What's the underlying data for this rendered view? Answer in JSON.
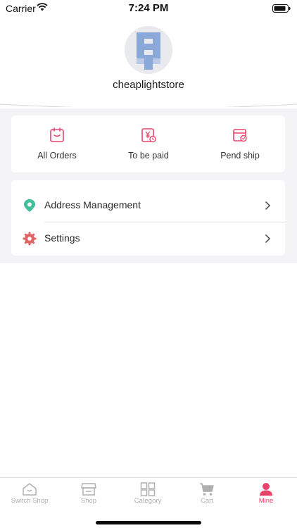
{
  "status_bar": {
    "carrier": "Carrier",
    "time": "7:24 PM"
  },
  "profile": {
    "username": "cheaplightstore"
  },
  "orders": [
    {
      "label": "All Orders",
      "icon": "order-list-icon"
    },
    {
      "label": "To be paid",
      "icon": "payment-pending-icon"
    },
    {
      "label": "Pend ship",
      "icon": "pending-shipment-icon"
    }
  ],
  "menu": [
    {
      "label": "Address Management",
      "icon": "location-pin-icon"
    },
    {
      "label": "Settings",
      "icon": "gear-icon"
    }
  ],
  "tabs": [
    {
      "label": "Switch Shop",
      "icon": "home-switch-icon",
      "active": false
    },
    {
      "label": "Shop",
      "icon": "storefront-icon",
      "active": false
    },
    {
      "label": "Category",
      "icon": "grid-icon",
      "active": false
    },
    {
      "label": "Cart",
      "icon": "cart-icon",
      "active": false
    },
    {
      "label": "Mine",
      "icon": "person-icon",
      "active": true
    }
  ],
  "colors": {
    "accent": "#e8436a",
    "location": "#3fbf9a",
    "settings": "#e06666",
    "tab_inactive": "#b0b0b0"
  }
}
